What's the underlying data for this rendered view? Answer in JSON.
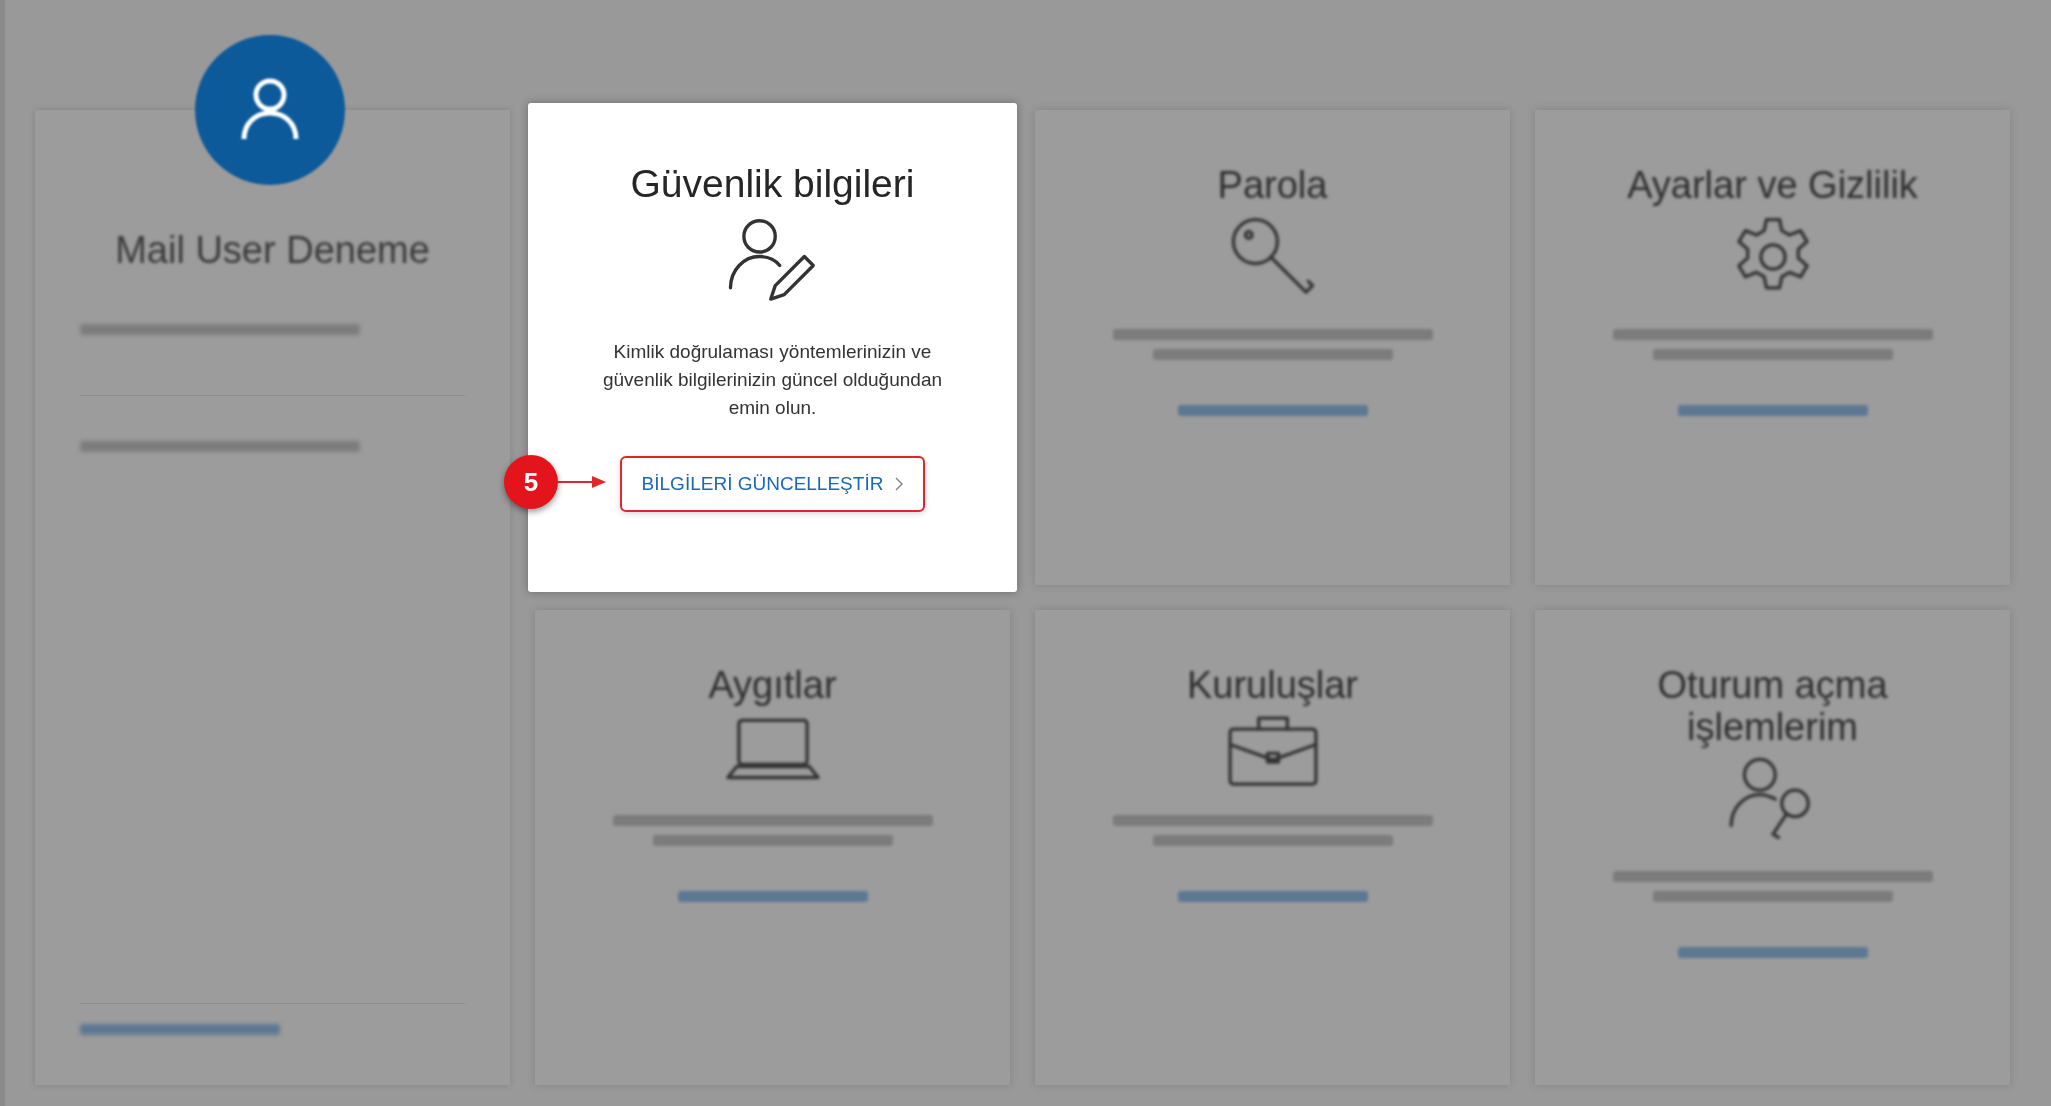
{
  "profile": {
    "name": "Mail User Deneme"
  },
  "cards": [
    {
      "kind": "security",
      "title": "Güvenlik bilgileri",
      "highlighted": true,
      "description": "Kimlik doğrulaması yöntemlerinizin ve güvenlik bilgilerinizin güncel olduğundan emin olun.",
      "action": "BİLGİLERİ GÜNCELLEŞTİR"
    },
    {
      "kind": "password",
      "title": "Parola",
      "highlighted": false
    },
    {
      "kind": "settings",
      "title": "Ayarlar ve Gizlilik",
      "highlighted": false
    },
    {
      "kind": "devices",
      "title": "Aygıtlar",
      "highlighted": false
    },
    {
      "kind": "organizations",
      "title": "Kuruluşlar",
      "highlighted": false
    },
    {
      "kind": "signins",
      "title": "Oturum açma işlemlerim",
      "highlighted": false
    }
  ],
  "annotation": {
    "number": "5"
  }
}
